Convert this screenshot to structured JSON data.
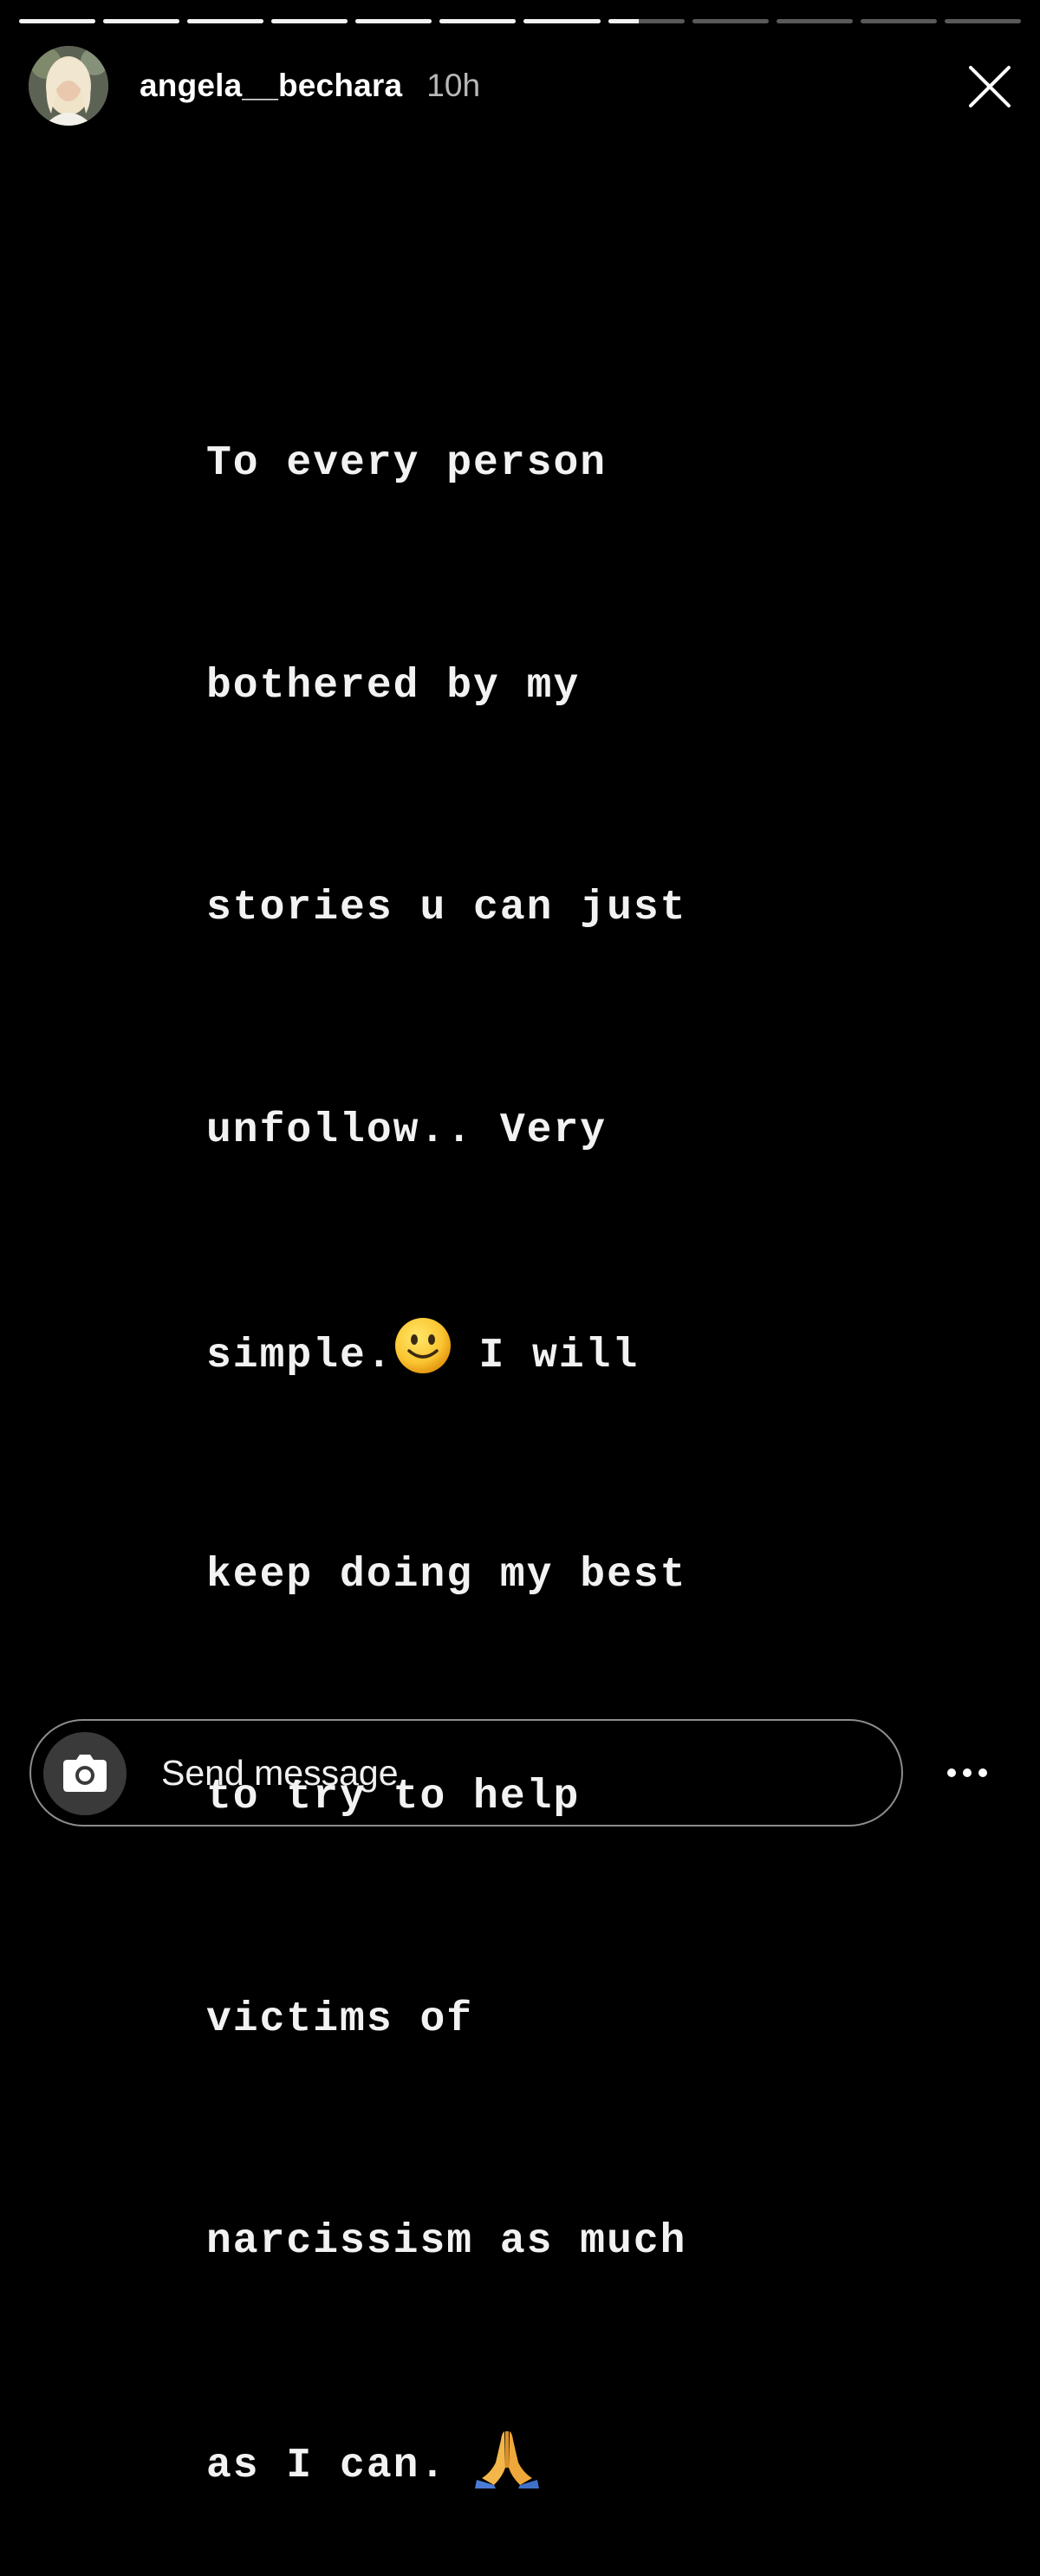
{
  "progress": {
    "segment_count": 12,
    "completed_segments": 7,
    "current_segment_progress": 0.4
  },
  "header": {
    "username": "angela__bechara",
    "timestamp": "10h"
  },
  "story": {
    "lines": [
      "To every person",
      "bothered by my",
      "stories u can just",
      "unfollow.. Very",
      "simple.",
      "keep doing my best",
      "to try to help",
      "victims of",
      "narcissism as much",
      "as I can. "
    ],
    "line5_suffix": " I will"
  },
  "footer": {
    "message_placeholder": "Send message"
  },
  "icons": {
    "close": "close-icon",
    "camera": "camera-icon",
    "more": "more-icon",
    "smile": "slightly-smiling-face-emoji",
    "pray": "folded-hands-emoji"
  },
  "colors": {
    "background": "#000000",
    "text": "#ffffff",
    "progress_track": "rgba(255,255,255,0.35)",
    "progress_fill": "rgba(255,255,255,0.92)"
  }
}
